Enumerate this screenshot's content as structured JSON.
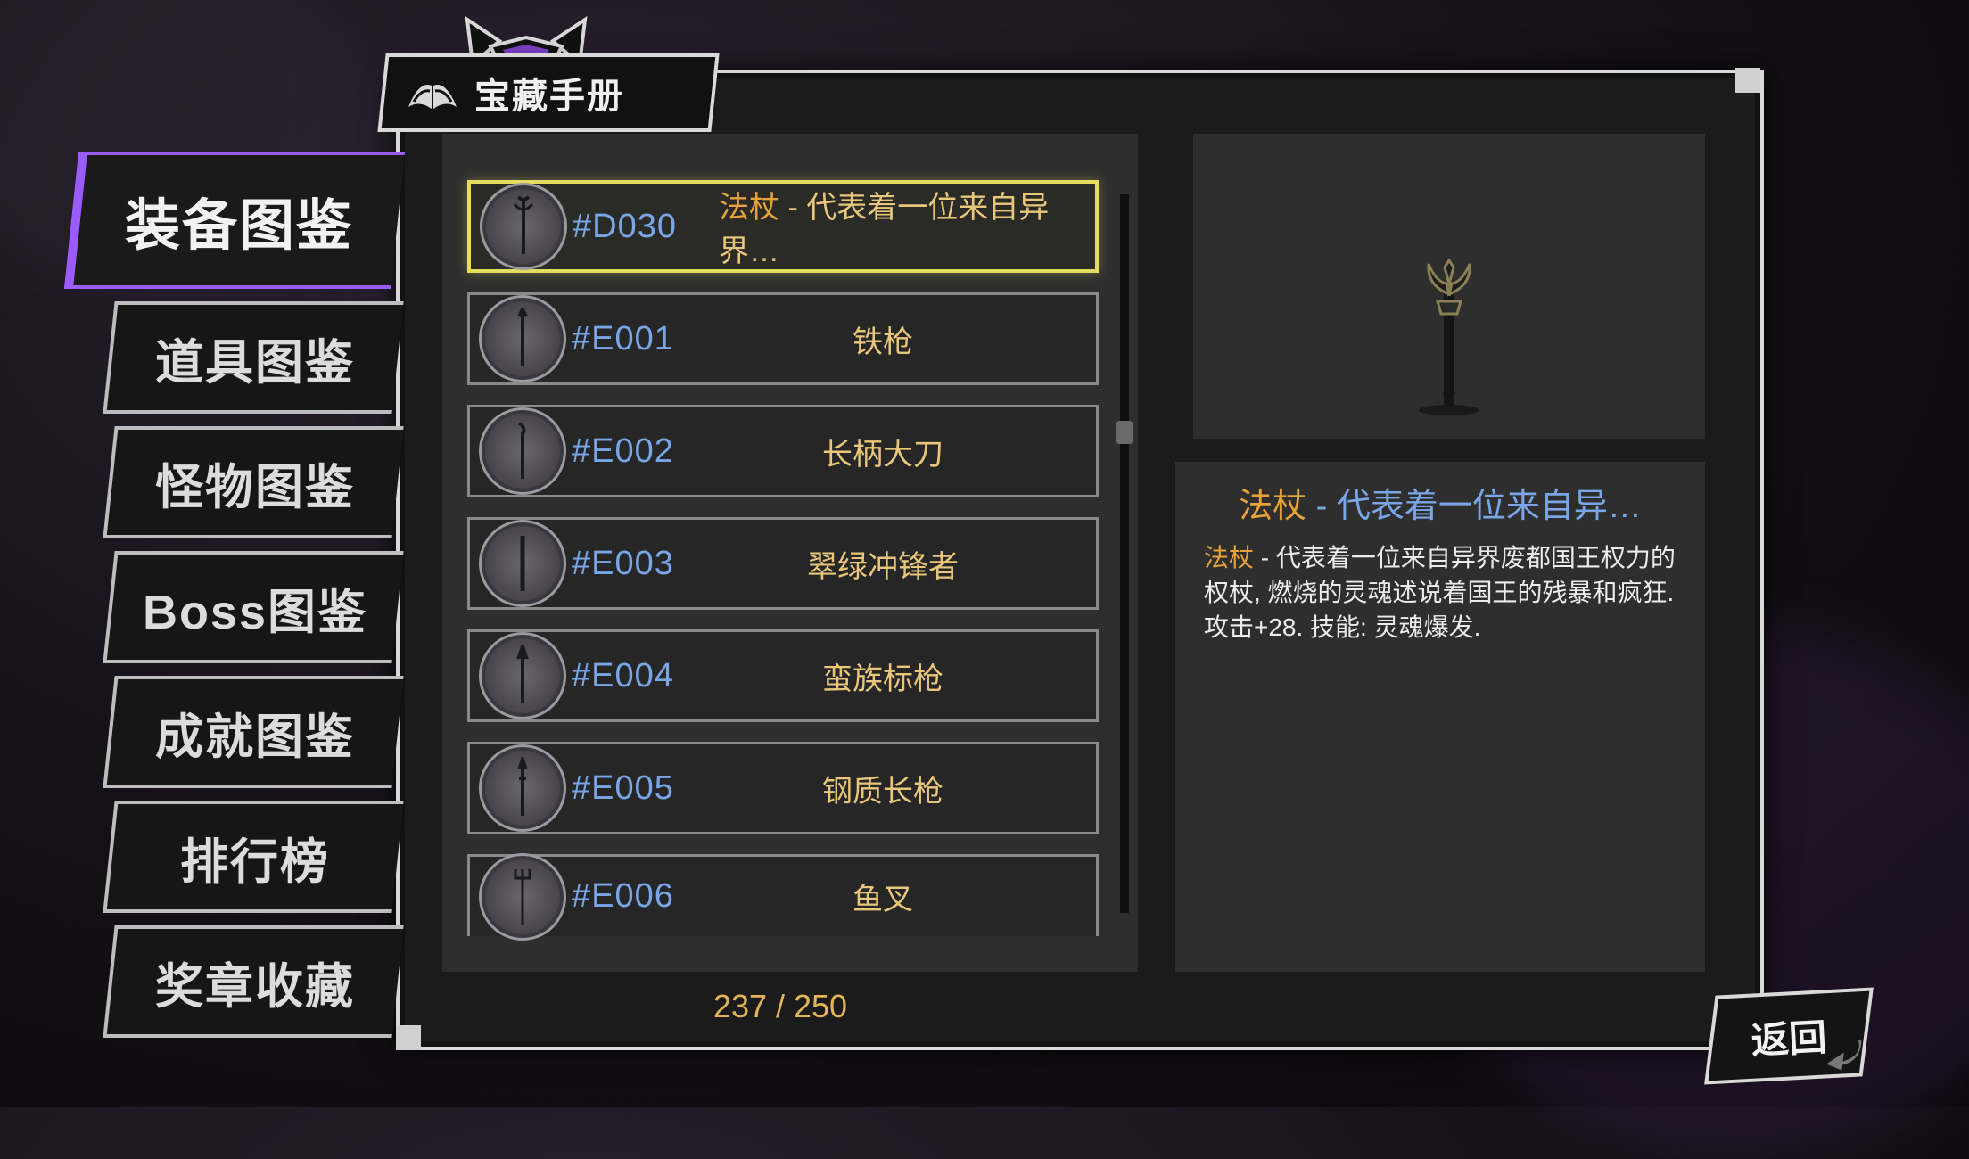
{
  "header": {
    "title": "宝藏手册"
  },
  "sidebar": {
    "items": [
      {
        "label": "装备图鉴",
        "active": true
      },
      {
        "label": "道具图鉴",
        "active": false
      },
      {
        "label": "怪物图鉴",
        "active": false
      },
      {
        "label": "Boss图鉴",
        "active": false
      },
      {
        "label": "成就图鉴",
        "active": false
      },
      {
        "label": "排行榜",
        "active": false
      },
      {
        "label": "奖章收藏",
        "active": false
      }
    ]
  },
  "list": {
    "rows": [
      {
        "code": "#D030",
        "name_prefix": "法杖",
        "name_suffix": " - 代表着一位来自异界…",
        "selected": true
      },
      {
        "code": "#E001",
        "name": "铁枪",
        "selected": false
      },
      {
        "code": "#E002",
        "name": "长柄大刀",
        "selected": false
      },
      {
        "code": "#E003",
        "name": "翠绿冲锋者",
        "selected": false
      },
      {
        "code": "#E004",
        "name": "蛮族标枪",
        "selected": false
      },
      {
        "code": "#E005",
        "name": "钢质长枪",
        "selected": false
      },
      {
        "code": "#E006",
        "name": "鱼叉",
        "selected": false
      }
    ],
    "counter": "237 / 250"
  },
  "detail": {
    "title_prefix": "法杖",
    "title_suffix": " - 代表着一位来自异…",
    "body_prefix": "法杖",
    "body_rest": " - 代表着一位来自异界废都国王权力的权杖, 燃烧的灵魂述说着国王的残暴和疯狂.",
    "stats": "攻击+28. 技能: 灵魂爆发."
  },
  "back_button": {
    "label": "返回"
  },
  "colors": {
    "accent_purple": "#9b5cff",
    "code_blue": "#7aa6e8",
    "name_gold": "#e9c77a",
    "highlight_orange": "#e8a23a",
    "selected_border": "#e5dd60"
  },
  "icons": [
    "book-icon",
    "horns-icon",
    "weapon-medal-icon",
    "staff-icon",
    "back-arrow-icon"
  ]
}
